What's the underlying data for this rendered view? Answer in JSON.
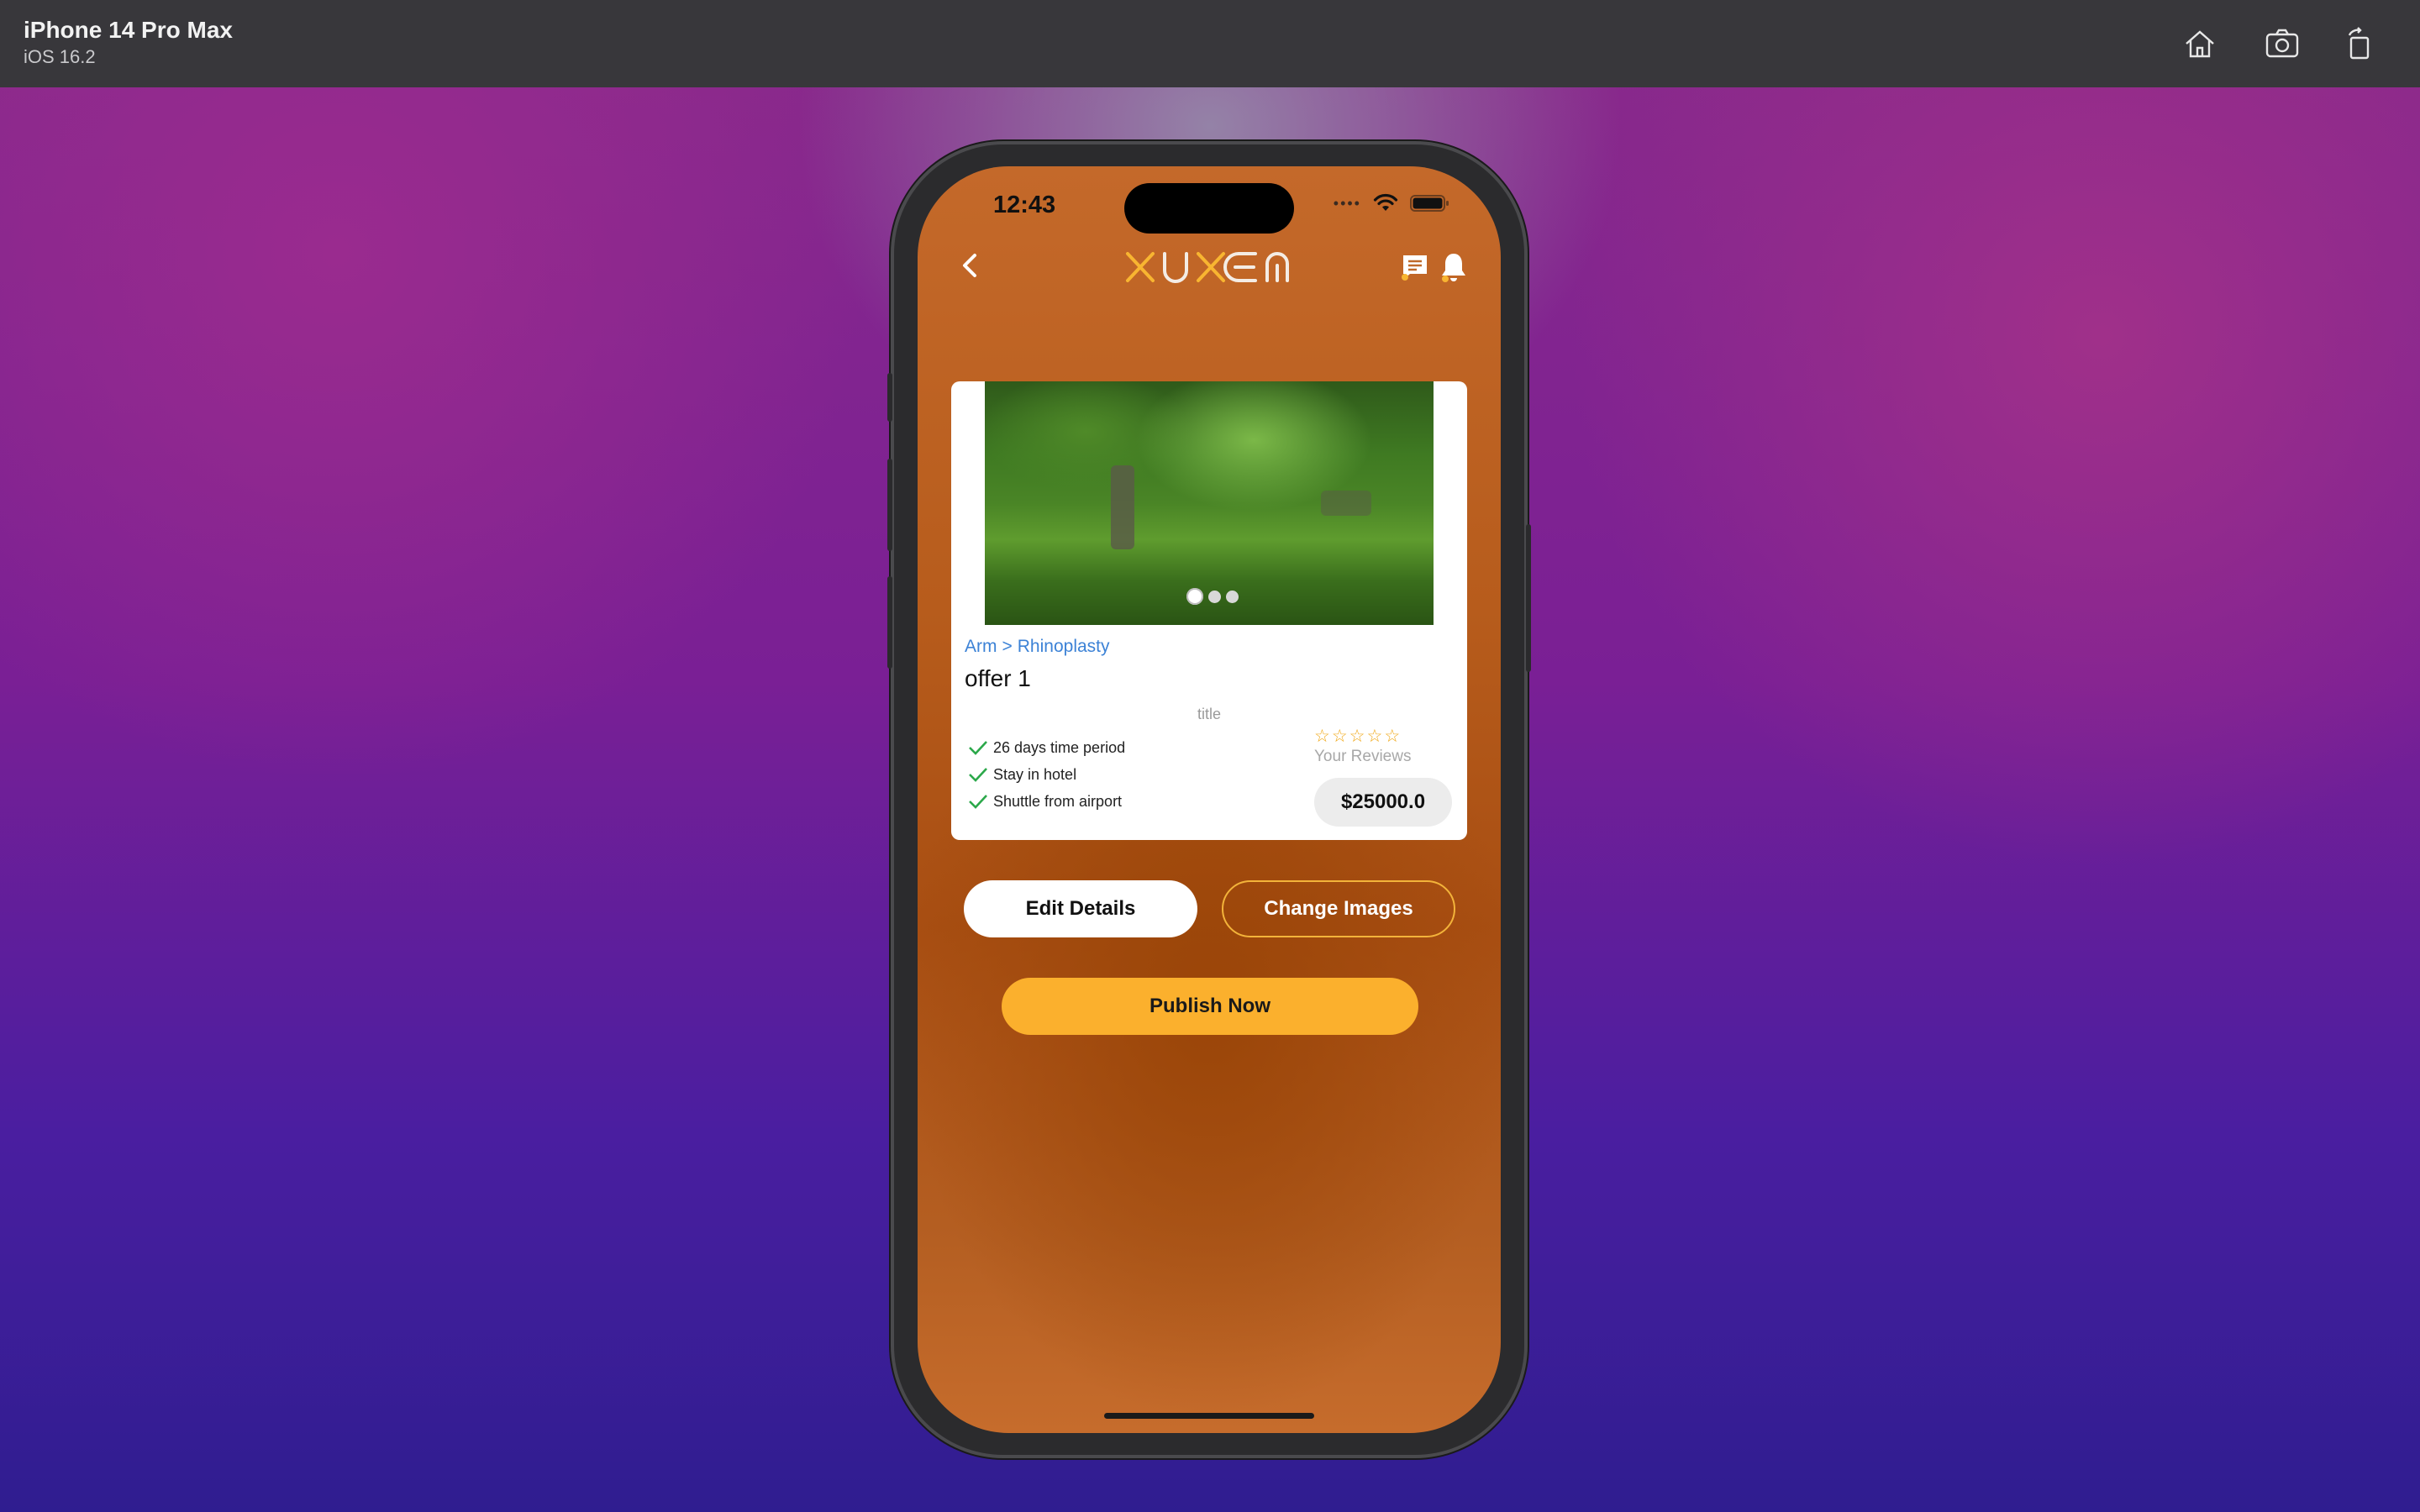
{
  "simulator": {
    "device_name": "iPhone 14 Pro Max",
    "os_version": "iOS 16.2",
    "toolbar_icons": [
      "home-icon",
      "screenshot-icon",
      "rotate-icon"
    ]
  },
  "status_bar": {
    "time": "12:43",
    "icons": [
      "cellular-dots-icon",
      "wifi-icon",
      "battery-icon"
    ]
  },
  "nav": {
    "logo_text": "XUXEM",
    "logo_colors": {
      "accent": "#f8b531",
      "light": "#f4ece4"
    },
    "icons": [
      "back-icon",
      "chat-icon",
      "bell-icon"
    ]
  },
  "offer": {
    "breadcrumb": [
      "Arm",
      ">",
      "Rhinoplasty"
    ],
    "title": "offer 1",
    "subtitle": "title",
    "features": [
      "26 days time period",
      "Stay in hotel",
      "Shuttle from airport"
    ],
    "rating_stars": 0,
    "rating_max": 5,
    "reviews_label": "Your Reviews",
    "price": "$25000.0",
    "image_count": 3,
    "active_image": 1
  },
  "actions": {
    "edit_label": "Edit Details",
    "change_images_label": "Change Images",
    "publish_label": "Publish Now"
  },
  "colors": {
    "primary": "#fbb02d",
    "screen_bg": "#b75c1c",
    "link": "#3c82d6",
    "check": "#2ba84a"
  }
}
